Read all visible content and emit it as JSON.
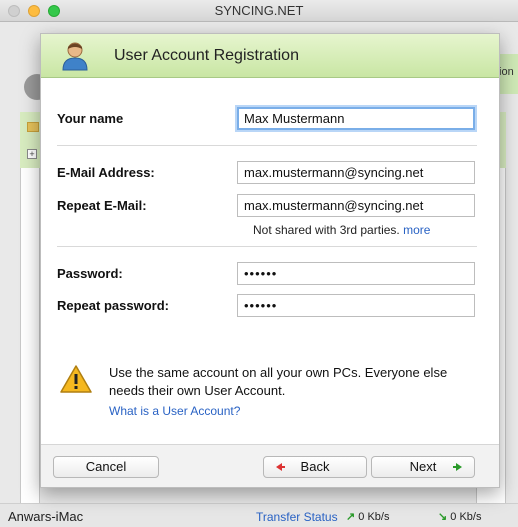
{
  "window": {
    "title": "SYNCING.NET",
    "background_partial_text": "tion"
  },
  "dialog": {
    "title": "User Account Registration",
    "fields": {
      "name": {
        "label": "Your name",
        "value": "Max Mustermann"
      },
      "email": {
        "label": "E-Mail Address:",
        "value": "max.mustermann@syncing.net"
      },
      "repeat_email": {
        "label": "Repeat E-Mail:",
        "value": "max.mustermann@syncing.net"
      },
      "password": {
        "label": "Password:",
        "value": "••••••"
      },
      "repeat_password": {
        "label": "Repeat password:",
        "value": "••••••"
      }
    },
    "privacy_note": "Not shared with 3rd parties.",
    "privacy_more": "more",
    "warning_text": "Use the same account on all your own PCs. Everyone else needs their own User Account.",
    "warning_link": "What is a User Account?",
    "buttons": {
      "cancel": "Cancel",
      "back": "Back",
      "next": "Next"
    }
  },
  "statusbar": {
    "host": "Anwars-iMac",
    "transfer_status": "Transfer Status",
    "upload": "0 Kb/s",
    "download": "0 Kb/s"
  },
  "colors": {
    "header_green": "#c9e6a4",
    "link_blue": "#2962c4",
    "focus_blue": "#7aaee8"
  }
}
